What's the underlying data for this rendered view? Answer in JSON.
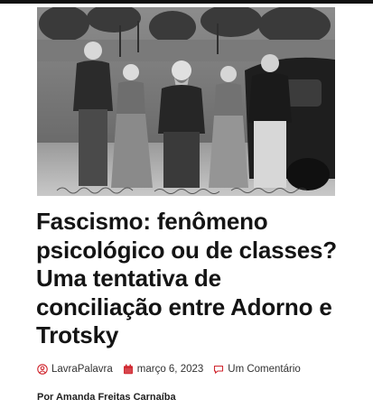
{
  "article": {
    "title": "Fascismo: fenômeno psicológico ou de classes? Uma tentativa de conciliação entre Adorno e Trotsky",
    "meta": {
      "author": "LavraPalavra",
      "date": "março 6, 2023",
      "comments": "Um Comentário"
    },
    "byline": "Por Amanda Freitas Carnaíba"
  },
  "hero_image": {
    "description": "black-and-white photo of five people standing outdoors in front of a car",
    "caption_handwritten": true
  },
  "colors": {
    "accent": "#d0262e",
    "text": "#141414",
    "meta_text": "#333333",
    "top_bar": "#111111"
  },
  "icons": {
    "author": "user-circle-icon",
    "date": "calendar-icon",
    "comments": "speech-bubble-icon"
  }
}
